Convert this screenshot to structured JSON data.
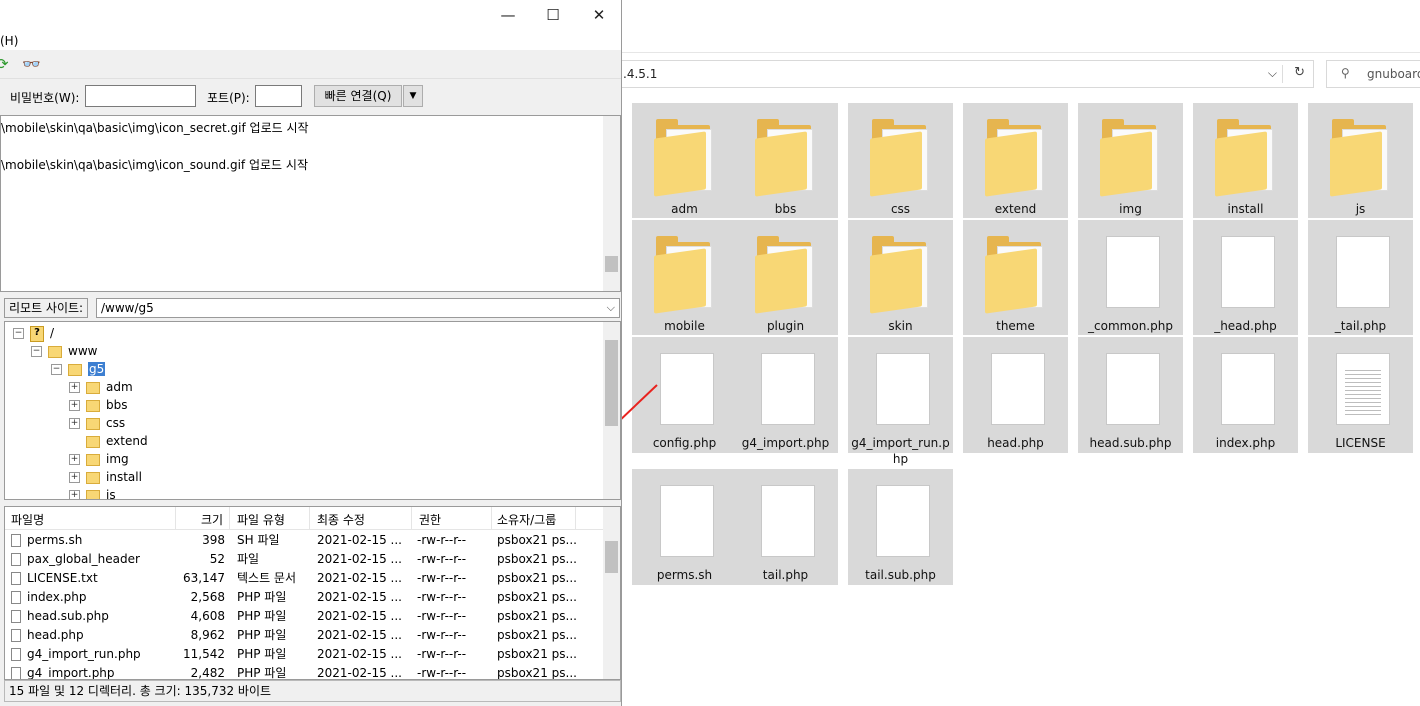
{
  "explorer": {
    "address": ".4.5.1",
    "search_placeholder": "gnuboard",
    "items": [
      {
        "name": "adm",
        "kind": "folder"
      },
      {
        "name": "bbs",
        "kind": "folder"
      },
      {
        "name": "css",
        "kind": "folder"
      },
      {
        "name": "extend",
        "kind": "folder"
      },
      {
        "name": "img",
        "kind": "folder"
      },
      {
        "name": "install",
        "kind": "folder"
      },
      {
        "name": "js",
        "kind": "folder"
      },
      {
        "name": "mobile",
        "kind": "folder"
      },
      {
        "name": "plugin",
        "kind": "folder"
      },
      {
        "name": "skin",
        "kind": "folder"
      },
      {
        "name": "theme",
        "kind": "folder"
      },
      {
        "name": "_common.php",
        "kind": "file"
      },
      {
        "name": "_head.php",
        "kind": "file"
      },
      {
        "name": "_tail.php",
        "kind": "file"
      },
      {
        "name": "config.php",
        "kind": "file"
      },
      {
        "name": "g4_import.php",
        "kind": "file"
      },
      {
        "name": "g4_import_run.php",
        "kind": "file"
      },
      {
        "name": "head.php",
        "kind": "file"
      },
      {
        "name": "head.sub.php",
        "kind": "file"
      },
      {
        "name": "index.php",
        "kind": "file"
      },
      {
        "name": "LICENSE",
        "kind": "text"
      },
      {
        "name": "perms.sh",
        "kind": "file"
      },
      {
        "name": "tail.php",
        "kind": "file"
      },
      {
        "name": "tail.sub.php",
        "kind": "file"
      }
    ]
  },
  "filezilla": {
    "window": {
      "minimize": "—",
      "maximize": "☐",
      "close": "✕"
    },
    "menu": {
      "help": "(H)"
    },
    "quickconnect": {
      "password_label": "비밀번호(W):",
      "port_label": "포트(P):",
      "connect_button": "빠른 연결(Q)",
      "dropdown": "▼"
    },
    "log": [
      "\\mobile\\skin\\qa\\basic\\img\\icon_secret.gif 업로드 시작",
      "\\mobile\\skin\\qa\\basic\\img\\icon_sound.gif 업로드 시작"
    ],
    "remote": {
      "label": "리모트 사이트:",
      "path": "/www/g5"
    },
    "tree": {
      "root": "/",
      "www": "www",
      "g5": "g5",
      "children": [
        "adm",
        "bbs",
        "css",
        "extend",
        "img",
        "install",
        "js"
      ]
    },
    "filelist": {
      "columns": [
        "파일명",
        "크기",
        "파일 유형",
        "최종 수정",
        "권한",
        "소유자/그룹"
      ],
      "rows": [
        {
          "name": "perms.sh",
          "size": "398",
          "type": "SH 파일",
          "modified": "2021-02-15 ...",
          "perm": "-rw-r--r--",
          "owner": "psbox21 ps..."
        },
        {
          "name": "pax_global_header",
          "size": "52",
          "type": "파일",
          "modified": "2021-02-15 ...",
          "perm": "-rw-r--r--",
          "owner": "psbox21 ps..."
        },
        {
          "name": "LICENSE.txt",
          "size": "63,147",
          "type": "텍스트 문서",
          "modified": "2021-02-15 ...",
          "perm": "-rw-r--r--",
          "owner": "psbox21 ps..."
        },
        {
          "name": "index.php",
          "size": "2,568",
          "type": "PHP 파일",
          "modified": "2021-02-15 ...",
          "perm": "-rw-r--r--",
          "owner": "psbox21 ps..."
        },
        {
          "name": "head.sub.php",
          "size": "4,608",
          "type": "PHP 파일",
          "modified": "2021-02-15 ...",
          "perm": "-rw-r--r--",
          "owner": "psbox21 ps..."
        },
        {
          "name": "head.php",
          "size": "8,962",
          "type": "PHP 파일",
          "modified": "2021-02-15 ...",
          "perm": "-rw-r--r--",
          "owner": "psbox21 ps..."
        },
        {
          "name": "g4_import_run.php",
          "size": "11,542",
          "type": "PHP 파일",
          "modified": "2021-02-15 ...",
          "perm": "-rw-r--r--",
          "owner": "psbox21 ps..."
        },
        {
          "name": "g4_import.php",
          "size": "2,482",
          "type": "PHP 파일",
          "modified": "2021-02-15 ...",
          "perm": "-rw-r--r--",
          "owner": "psbox21 ps..."
        }
      ]
    },
    "status": "15 파일 및 12 디렉터리. 총 크기: 135,732 바이트"
  },
  "colors": {
    "annotation_arrow": "#e8231f",
    "selection": "#3d7fd1",
    "folder": "#f8d775"
  }
}
